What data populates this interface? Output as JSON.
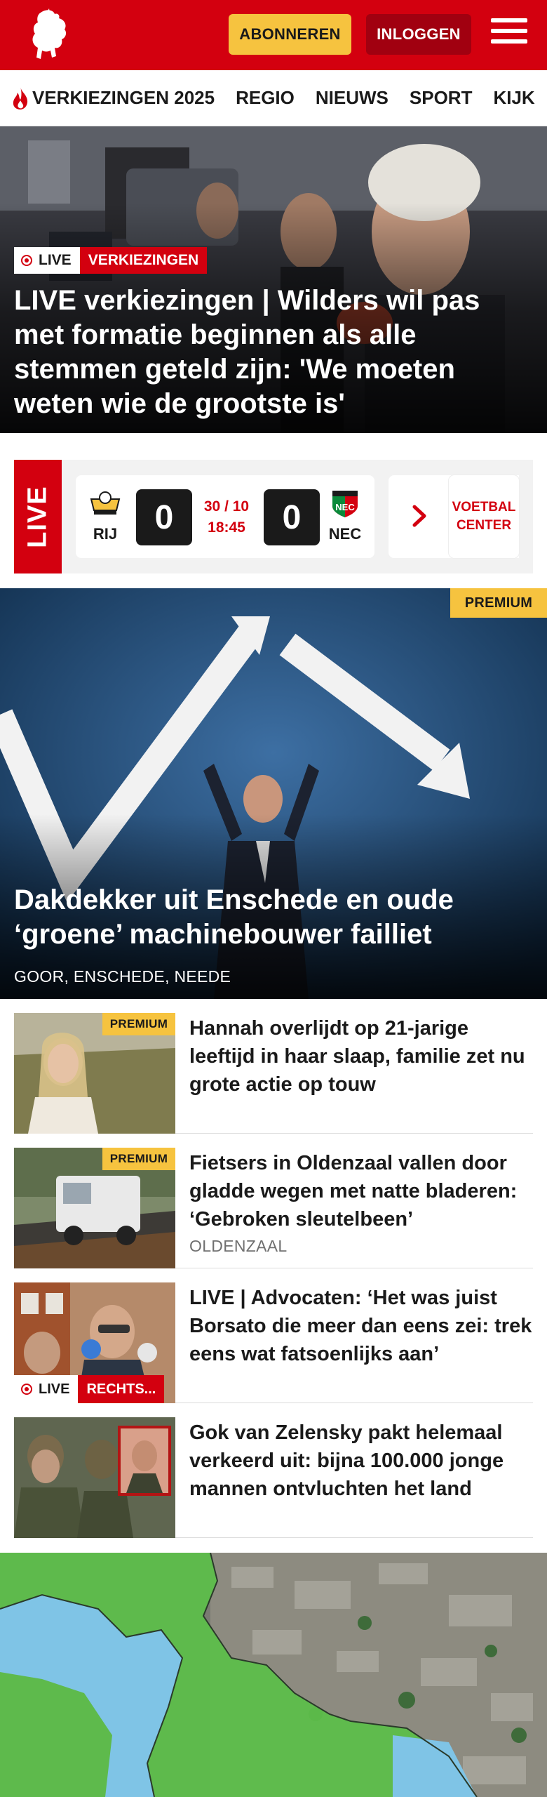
{
  "header": {
    "subscribe_label": "ABONNEREN",
    "login_label": "INLOGGEN",
    "brand_color": "#d3000f",
    "accent_color": "#f6c33f"
  },
  "nav": {
    "items": [
      "VERKIEZINGEN 2025",
      "REGIO",
      "NIEUWS",
      "SPORT",
      "KIJK"
    ]
  },
  "hero": {
    "live_label": "LIVE",
    "category": "VERKIEZINGEN",
    "title": "LIVE verkiezingen | Wilders wil pas met formatie beginnen als alle stemmen geteld zijn: 'We moeten weten wie de grootste is'"
  },
  "live_score": {
    "label": "LIVE",
    "home_team": "RIJ",
    "away_team": "NEC",
    "home_score": "0",
    "away_score": "0",
    "date": "30 / 10",
    "time": "18:45",
    "center_label": "VOETBAL CENTER"
  },
  "premium_hero": {
    "badge": "PREMIUM",
    "title": "Dakdekker uit Enschede en oude ‘groene’ machinebouwer failliet",
    "locations": "GOOR, ENSCHEDE, NEEDE"
  },
  "articles": [
    {
      "badge": "PREMIUM",
      "title": "Hannah overlijdt op 21-jarige leeftijd in haar slaap, familie zet nu grote actie op touw",
      "location": ""
    },
    {
      "badge": "PREMIUM",
      "title": "Fietsers in Oldenzaal vallen door gladde wegen met natte bladeren: ‘Gebroken sleutelbeen’",
      "location": "OLDENZAAL"
    },
    {
      "live_label": "LIVE",
      "category": "RECHTS...",
      "title": "LIVE | Advocaten: ‘Het was juist Borsato die meer dan eens zei: trek eens wat fatsoenlijks aan’",
      "location": ""
    },
    {
      "title": "Gok van Zelensky pakt helemaal verkeerd uit: bijna 100.000 jonge mannen ontvluchten het land",
      "location": ""
    }
  ]
}
